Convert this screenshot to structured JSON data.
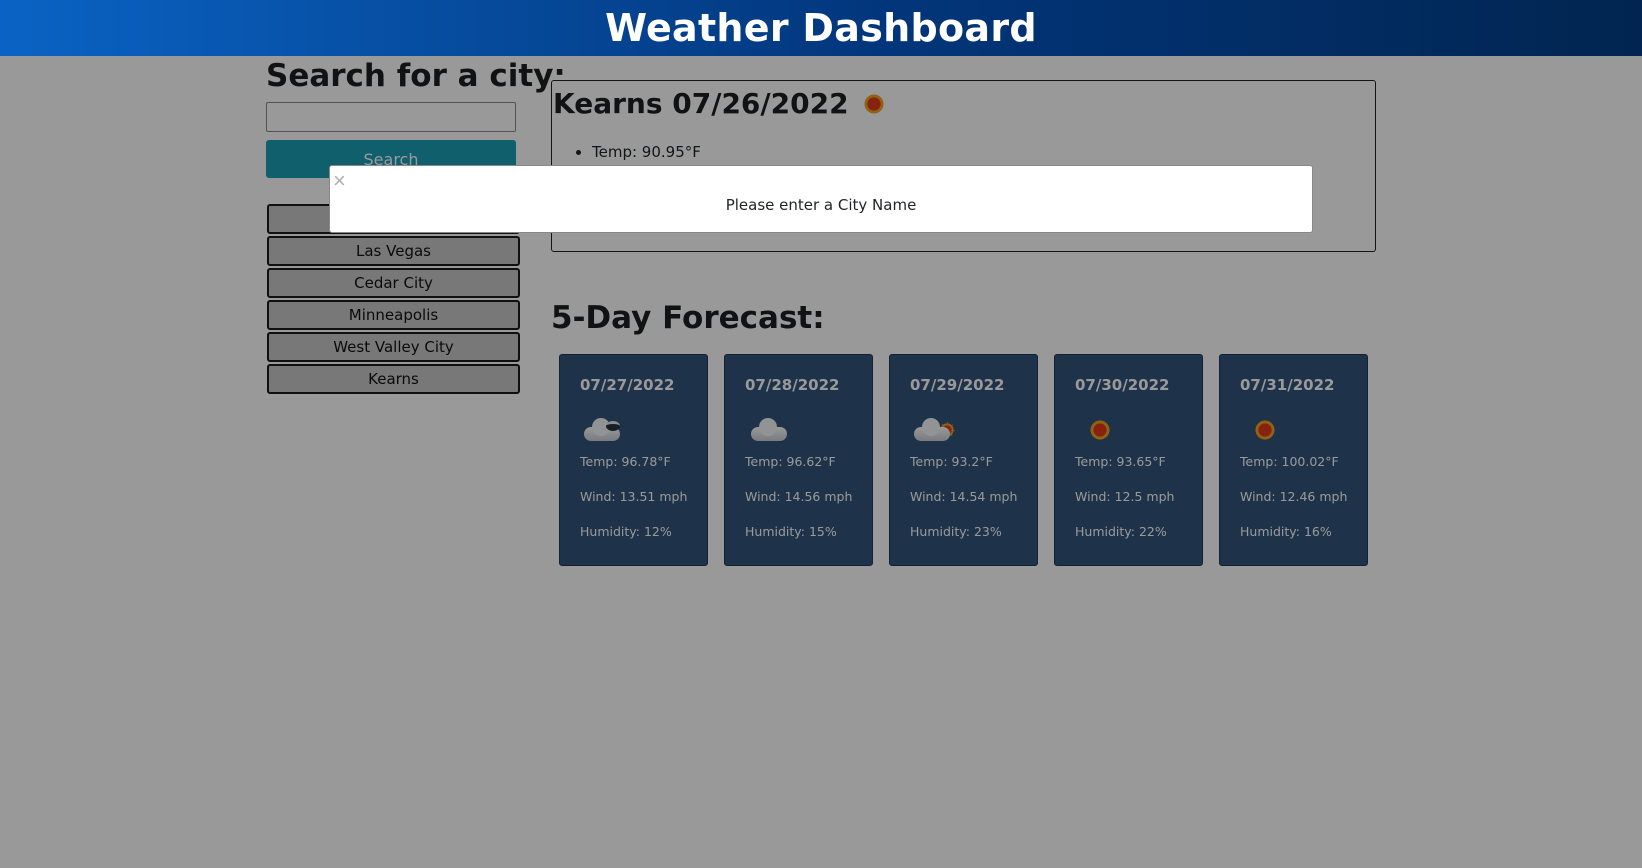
{
  "header": {
    "title": "Weather Dashboard"
  },
  "sidebar": {
    "heading": "Search for a city:",
    "search_value": "",
    "search_button": "Search",
    "history": [
      "",
      "Las Vegas",
      "Cedar City",
      "Minneapolis",
      "West Valley City",
      "Kearns"
    ]
  },
  "current": {
    "city_date": "Kearns 07/26/2022",
    "icon": "sun-icon",
    "details": [
      "Temp: 90.95°F",
      "",
      "",
      ""
    ]
  },
  "forecast": {
    "heading": "5-Day Forecast:",
    "days": [
      {
        "date": "07/27/2022",
        "icon": "cloud-night-icon",
        "temp": "Temp: 96.78°F",
        "wind": "Wind: 13.51 mph",
        "humidity": "Humidity: 12%"
      },
      {
        "date": "07/28/2022",
        "icon": "cloud-icon",
        "temp": "Temp: 96.62°F",
        "wind": "Wind: 14.56 mph",
        "humidity": "Humidity: 15%"
      },
      {
        "date": "07/29/2022",
        "icon": "cloud-sun-icon",
        "temp": "Temp: 93.2°F",
        "wind": "Wind: 14.54 mph",
        "humidity": "Humidity: 23%"
      },
      {
        "date": "07/30/2022",
        "icon": "sun-icon",
        "temp": "Temp: 93.65°F",
        "wind": "Wind: 12.5 mph",
        "humidity": "Humidity: 22%"
      },
      {
        "date": "07/31/2022",
        "icon": "sun-icon",
        "temp": "Temp: 100.02°F",
        "wind": "Wind: 12.46 mph",
        "humidity": "Humidity: 16%"
      }
    ]
  },
  "modal": {
    "close": "×",
    "message": "Please enter a City Name"
  }
}
